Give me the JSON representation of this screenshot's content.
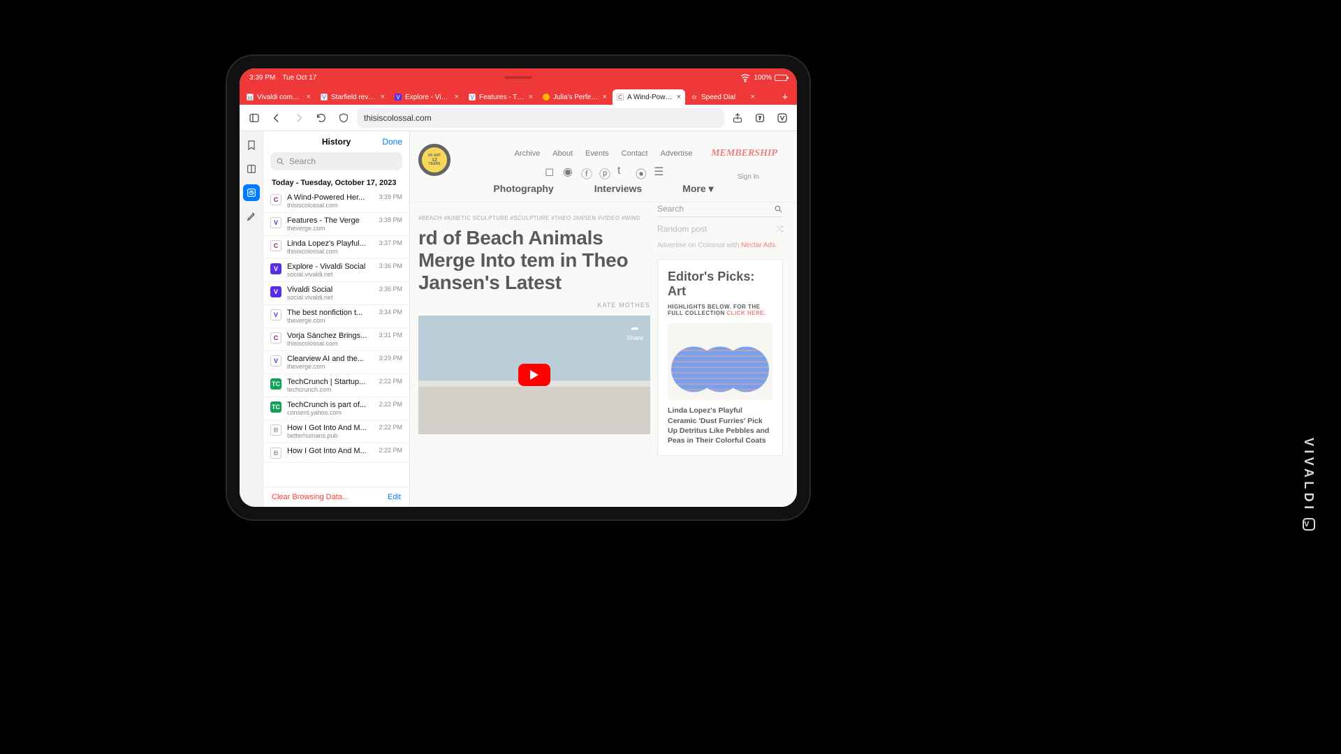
{
  "status_bar": {
    "time": "3:39 PM",
    "date": "Tue Oct 17",
    "wifi": true,
    "battery_pct": "100%"
  },
  "tabs": [
    {
      "title": "Vivaldi communi",
      "favicon": "doc",
      "active": false
    },
    {
      "title": "Starfield review",
      "favicon": "verge",
      "active": false
    },
    {
      "title": "Explore - Vivaldi",
      "favicon": "vsocial",
      "active": false
    },
    {
      "title": "Features - The V",
      "favicon": "verge",
      "active": false
    },
    {
      "title": "Julia's Perfect S",
      "favicon": "dot",
      "active": false
    },
    {
      "title": "A Wind-Powered",
      "favicon": "colossal",
      "active": true
    },
    {
      "title": "Speed Dial",
      "favicon": "dial",
      "active": false
    }
  ],
  "toolbar": {
    "url": "thisiscolossal.com"
  },
  "side_rail": {
    "items": [
      "bookmarks",
      "panels",
      "history",
      "notes"
    ],
    "active": 2
  },
  "history": {
    "title": "History",
    "done": "Done",
    "search_placeholder": "Search",
    "date_header": "Today - Tuesday, October 17, 2023",
    "items": [
      {
        "title": "A Wind-Powered Her...",
        "url": "thisiscolossal.com",
        "time": "3:39 PM",
        "fav": "colossal"
      },
      {
        "title": "Features - The Verge",
        "url": "theverge.com",
        "time": "3:38 PM",
        "fav": "verge"
      },
      {
        "title": "Linda Lopez's Playful...",
        "url": "thisiscolossal.com",
        "time": "3:37 PM",
        "fav": "colossal"
      },
      {
        "title": "Explore - Vivaldi Social",
        "url": "social.vivaldi.net",
        "time": "3:36 PM",
        "fav": "vsocial"
      },
      {
        "title": "Vivaldi Social",
        "url": "social.vivaldi.net",
        "time": "3:36 PM",
        "fav": "vsocial"
      },
      {
        "title": "The best nonfiction t...",
        "url": "theverge.com",
        "time": "3:34 PM",
        "fav": "verge"
      },
      {
        "title": "Vorja Sánchez Brings...",
        "url": "thisiscolossal.com",
        "time": "3:31 PM",
        "fav": "colossal"
      },
      {
        "title": "Clearview AI and the...",
        "url": "theverge.com",
        "time": "3:29 PM",
        "fav": "verge"
      },
      {
        "title": "TechCrunch | Startup...",
        "url": "techcrunch.com",
        "time": "2:22 PM",
        "fav": "tc"
      },
      {
        "title": "TechCrunch is part of...",
        "url": "consent.yahoo.com",
        "time": "2:22 PM",
        "fav": "tc"
      },
      {
        "title": "How I Got Into And M...",
        "url": "betterhumans.pub",
        "time": "2:22 PM",
        "fav": "blank"
      },
      {
        "title": "How I Got Into And M...",
        "url": "",
        "time": "2:22 PM",
        "fav": "blank"
      }
    ],
    "clear": "Clear Browsing Data...",
    "edit": "Edit"
  },
  "page": {
    "topnav": [
      "Archive",
      "About",
      "Events",
      "Contact",
      "Advertise"
    ],
    "membership": "MEMBERSHIP",
    "signin": "Sign In",
    "nav2": [
      "Photography",
      "Interviews",
      "More ▾"
    ],
    "search_placeholder": "Search",
    "random": "Random post",
    "ad_text": "Advertise on Colossal with ",
    "ad_link": "Nectar Ads.",
    "tags": "#BEACH  #KINETIC SCULPTURE  #SCULPTURE  #THEO JANSEN  #VIDEO  #WIND",
    "headline": "rd of Beach Animals Merge Into tem in Theo Jansen's Latest",
    "byline": "KATE MOTHES",
    "share": "Share",
    "picks_title": "Editor's Picks: Art",
    "picks_sub_a": "HIGHLIGHTS BELOW. FOR THE FULL COLLECTION ",
    "picks_sub_b": "CLICK HERE.",
    "pick_caption": "Linda Lopez's Playful Ceramic 'Dust Furries' Pick Up Detritus Like Pebbles and Peas in Their Colorful Coats",
    "logo_up": "OF ART",
    "logo_mid": "12",
    "logo_dn": "YEARS"
  },
  "watermark": "VIVALDI"
}
